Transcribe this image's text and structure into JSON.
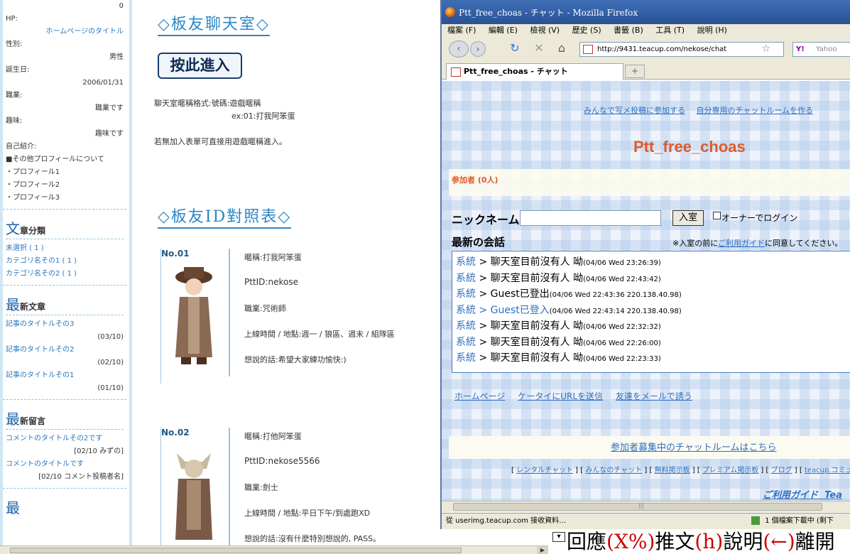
{
  "sidebar": {
    "profile_count": "0",
    "hp_label": "HP:",
    "hp_value": "ホームページのタイトル",
    "gender_label": "性別:",
    "gender_value": "男性",
    "birthday_label": "誕生日:",
    "birthday_value": "2006/01/31",
    "job_label": "職業:",
    "job_value": "職業です",
    "hobby_label": "趣味:",
    "hobby_value": "趣味です",
    "intro_label": "自己紹介:",
    "other_profile": "■その他プロフィールについて",
    "profile_items": [
      "・プロフィール1",
      "・プロフィール2",
      "・プロフィール3"
    ],
    "categories_title_first": "文",
    "categories_title_rest": "章分類",
    "categories": [
      "未選択 ( 1 )",
      "カテゴリ名その1 ( 1 )",
      "カテゴリ名その2 ( 1 )"
    ],
    "recent_title_first": "最",
    "recent_title_rest": "新文章",
    "recent_posts": [
      {
        "title": "記事のタイトルその3",
        "date": "(03/10)"
      },
      {
        "title": "記事のタイトルその2",
        "date": "(02/10)"
      },
      {
        "title": "記事のタイトルその1",
        "date": "(01/10)"
      }
    ],
    "comments_title_first": "最",
    "comments_title_rest": "新留言",
    "comments": [
      {
        "title": "コメントのタイトルその2です",
        "meta": "[02/10 みずの]"
      },
      {
        "title": "コメントのタイトルです",
        "meta": "[02/10 コメント投稿者名]"
      }
    ],
    "last_title_first": "最"
  },
  "blog": {
    "chat_header": "◇板友聊天室◇",
    "enter_label": "按此進入",
    "format_line1": "聊天室暱稱格式:號碼:遊戲暱稱",
    "format_line2": "ex:01:打我阿笨蛋",
    "no_form_line": "若無加入表單可直接用遊戲暱稱進入。",
    "id_header": "◇板友ID對照表◇",
    "members": [
      {
        "no": "No.01",
        "nickname": "暱稱:打我阿笨蛋",
        "pttid": "PttID:nekose",
        "job": "職業:咒術師",
        "online": "上線時間 / 地點:週一 / 狼區、週末 / 組隊區",
        "say": "想說的話:希望大家練功愉快:)"
      },
      {
        "no": "No.02",
        "nickname": "暱稱:打他阿笨蛋",
        "pttid": "PttID:nekose5566",
        "job": "職業:劍士",
        "online": "上線時間 / 地點:平日下午/到處跑XD",
        "say": "想說的話:沒有什麼特別想說的, PASS。"
      }
    ]
  },
  "firefox": {
    "window_title": "Ptt_free_choas - チャット - Mozilla Firefox",
    "menu": [
      "檔案 (F)",
      "編輯 (E)",
      "檢視 (V)",
      "歷史 (S)",
      "書籤 (B)",
      "工具 (T)",
      "說明 (H)"
    ],
    "back": "‹",
    "forward": "›",
    "reload": "↻",
    "stop": "✕",
    "home": "⌂",
    "url": "http://9431.teacup.com/nekose/chat",
    "star": "☆",
    "search_engine": "Y!",
    "search_placeholder": "Yahoo",
    "tab_title": "Ptt_free_choas - チャット",
    "new_tab": "+",
    "status_text": "從 userimg.teacup.com 接收資料…",
    "download_status": "1 個檔案下載中 (剩下",
    "scroll_grip": "|||"
  },
  "chat": {
    "top_links": [
      "みんなで写メ投稿に参加する",
      "自分専用のチャットルームを作る"
    ],
    "title": "Ptt_free_choas",
    "participants": "参加者 (0人)",
    "nickname_label": "ニックネーム",
    "enter_button": "入室",
    "owner_login": "オーナーでログイン",
    "recent_label": "最新の会話",
    "notice_pre": "※入室の前に",
    "notice_link": "ご利用ガイド",
    "notice_post": "に同意してください。",
    "messages": [
      {
        "who": "系統",
        "body": "聊天室目前沒有人 呦",
        "time": "(04/06 Wed 23:26:39)",
        "blue": false
      },
      {
        "who": "系統",
        "body": "聊天室目前沒有人 呦",
        "time": "(04/06 Wed 22:43:42)",
        "blue": false
      },
      {
        "who": "系統",
        "body": "Guest已登出",
        "time": "(04/06 Wed 22:43:36 220.138.40.98)",
        "blue": false
      },
      {
        "who": "系統",
        "body": "Guest已登入",
        "time": "(04/06 Wed 22:43:14 220.138.40.98)",
        "blue": true
      },
      {
        "who": "系統",
        "body": "聊天室目前沒有人 呦",
        "time": "(04/06 Wed 22:32:32)",
        "blue": false
      },
      {
        "who": "系統",
        "body": "聊天室目前沒有人 呦",
        "time": "(04/06 Wed 22:26:00)",
        "blue": false
      },
      {
        "who": "系統",
        "body": "聊天室目前沒有人 呦",
        "time": "(04/06 Wed 22:23:33)",
        "blue": false
      }
    ],
    "bottom_links": [
      "ホームページ",
      "ケータイにURLを送信",
      "友達をメールで誘う"
    ],
    "recruit_link": "参加者募集中のチャットルームはこちら",
    "service_links": [
      "レンタルチャット",
      "みんなのチャット",
      "無料掲示板",
      "プレミアム掲示板",
      "ブログ",
      "teacup.コミュ"
    ],
    "guide_link": "ご利用ガイド",
    "guide_link_2": "Tea"
  },
  "terminal": {
    "dropdown": "▾",
    "p1": "回應",
    "k1": "(X%)",
    "p2": "推文",
    "k2": "(h)",
    "p3": "說明",
    "k3": "(←)",
    "p4": "離開"
  }
}
